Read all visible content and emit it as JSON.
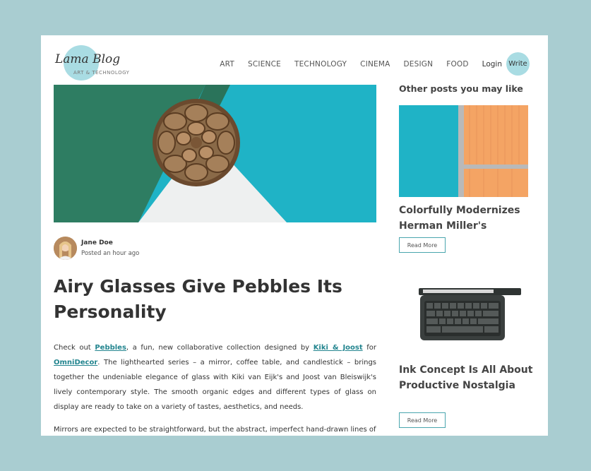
{
  "logo": {
    "title": "Lama Blog",
    "subtitle": "ART & TECHNOLOGY"
  },
  "nav": {
    "items": [
      "ART",
      "SCIENCE",
      "TECHNOLOGY",
      "CINEMA",
      "DESIGN",
      "FOOD"
    ],
    "login": "Login",
    "write": "Write"
  },
  "post": {
    "author": "Jane Doe",
    "posted": "Posted an hour ago",
    "title": "Airy Glasses Give Pebbles Its Personality",
    "paragraph1": {
      "t1": "Check out ",
      "link1": "Pebbles",
      "t2": ", a fun, new collaborative collection designed by ",
      "link2": "Kiki & Joost",
      "t3": " for ",
      "link3": "OmniDecor",
      "t4": ". The lighthearted series – a mirror, coffee table, and candlestick – brings together the undeniable elegance of glass with Kiki van Eijk's and Joost van Bleiswijk's lively contemporary style. The smooth organic edges and different types of glass on display are ready to take on a variety of tastes, aesthetics, and needs."
    },
    "paragraph2": "Mirrors are expected to be straightforward, but the abstract, imperfect hand-drawn lines of"
  },
  "sidebar": {
    "heading": "Other posts you may like",
    "posts": [
      {
        "title": "Colorfully Modernizes Herman Miller's",
        "button": "Read More"
      },
      {
        "title": "Ink Concept Is All About Productive Nostalgia",
        "button": "Read More"
      }
    ]
  },
  "colors": {
    "background": "#a9cdd1",
    "accent": "#a9dce3",
    "link": "#23858f"
  }
}
